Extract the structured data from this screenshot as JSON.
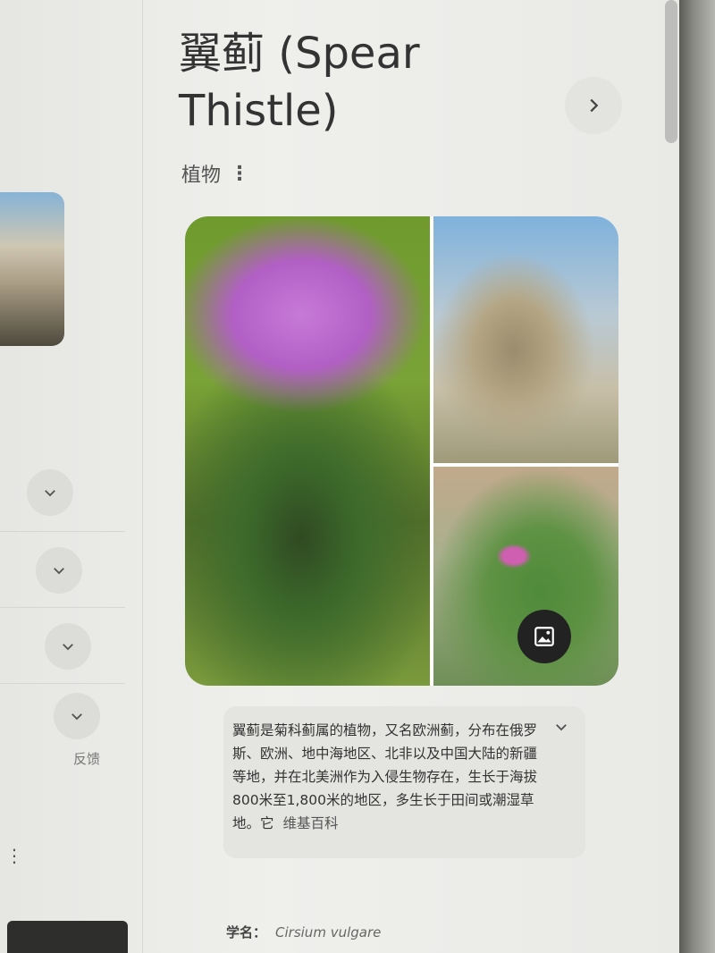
{
  "entity": {
    "title": "翼蓟 (Spear Thistle)",
    "category": "植物",
    "more_icon": "more-vert-icon"
  },
  "description": {
    "text": "翼蓟是菊科蓟属的植物，又名欧洲蓟，分布在俄罗斯、欧洲、地中海地区、北非以及中国大陆的新疆等地，并在北美洲作为入侵生物存在，生长于海拔800米至1,800米的地区，多生长于田间或潮湿草地。它",
    "source": "维基百科"
  },
  "facts": {
    "scientific_name_label": "学名：",
    "scientific_name_value": "Cirsium vulgare"
  },
  "left_panel": {
    "feedback_label": "反馈"
  },
  "icons": {
    "next": "chevron-right-icon",
    "expand": "chevron-down-icon",
    "images": "image-icon"
  },
  "colors": {
    "text_primary": "#333333",
    "card_bg": "#e4e4e1",
    "button_bg": "#dcdcd9"
  }
}
